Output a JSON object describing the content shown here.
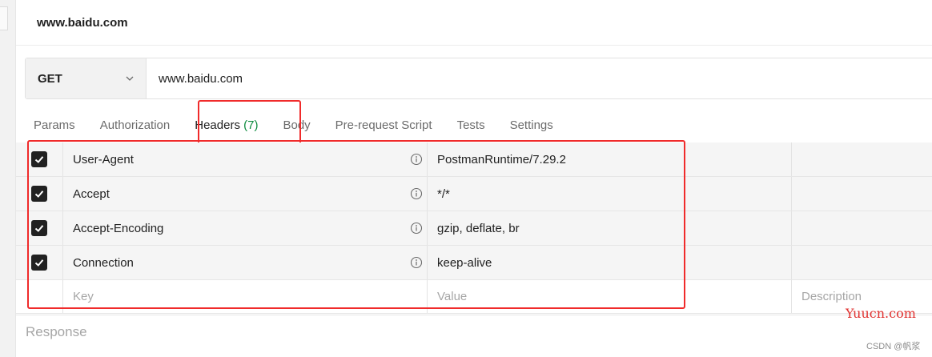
{
  "request": {
    "title": "www.baidu.com",
    "method": "GET",
    "url": "www.baidu.com"
  },
  "tabs": [
    {
      "label": "Params"
    },
    {
      "label": "Authorization"
    },
    {
      "label": "Headers",
      "count": "(7)"
    },
    {
      "label": "Body"
    },
    {
      "label": "Pre-request Script"
    },
    {
      "label": "Tests"
    },
    {
      "label": "Settings"
    }
  ],
  "headers": {
    "rows": [
      {
        "key": "User-Agent",
        "value": "PostmanRuntime/7.29.2",
        "checked": true
      },
      {
        "key": "Accept",
        "value": "*/*",
        "checked": true
      },
      {
        "key": "Accept-Encoding",
        "value": "gzip, deflate, br",
        "checked": true
      },
      {
        "key": "Connection",
        "value": "keep-alive",
        "checked": true
      }
    ],
    "placeholder": {
      "key": "Key",
      "value": "Value",
      "description": "Description"
    }
  },
  "response": {
    "label": "Response"
  },
  "watermark": {
    "site": "Yuucn.com",
    "credit": "CSDN @帆浆"
  },
  "colors": {
    "highlight": "#f02b2b",
    "tab_count": "#0c8a3d",
    "checkbox": "#212121"
  },
  "icons": {
    "method_chevron": "chevron-down-icon",
    "row_info": "info-icon",
    "row_checkbox": "checkmark-icon"
  }
}
